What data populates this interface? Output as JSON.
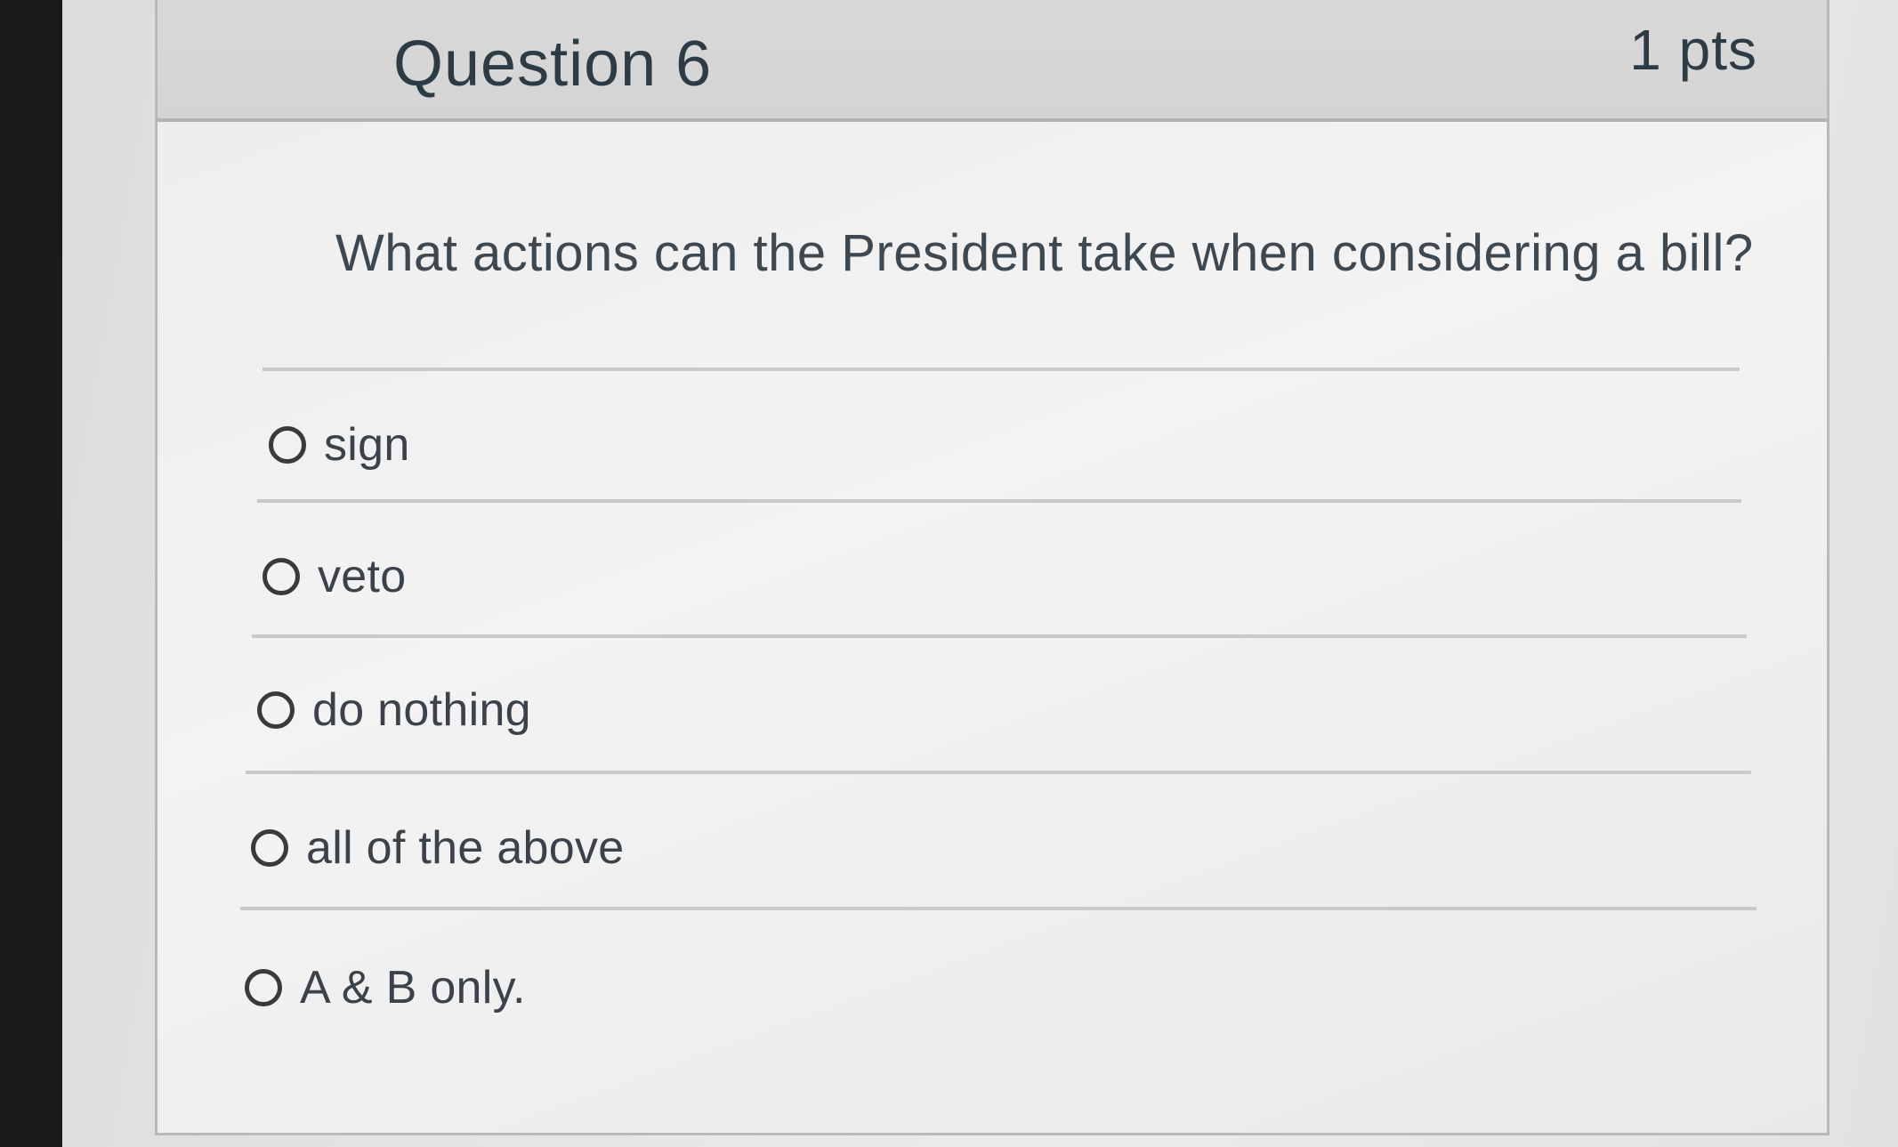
{
  "question": {
    "title": "Question 6",
    "points": "1 pts",
    "text": "What actions can the President take when considering a bill?"
  },
  "answers": [
    {
      "label": "sign",
      "selected": false
    },
    {
      "label": "veto",
      "selected": false
    },
    {
      "label": "do nothing",
      "selected": false
    },
    {
      "label": "all of the above",
      "selected": false
    },
    {
      "label": "A & B only.",
      "selected": false
    }
  ],
  "colors": {
    "header_bg": "#d4d4d4",
    "card_bg": "#f0f0f0",
    "text": "#2d3b45",
    "radio_border": "#3a3a3a"
  }
}
